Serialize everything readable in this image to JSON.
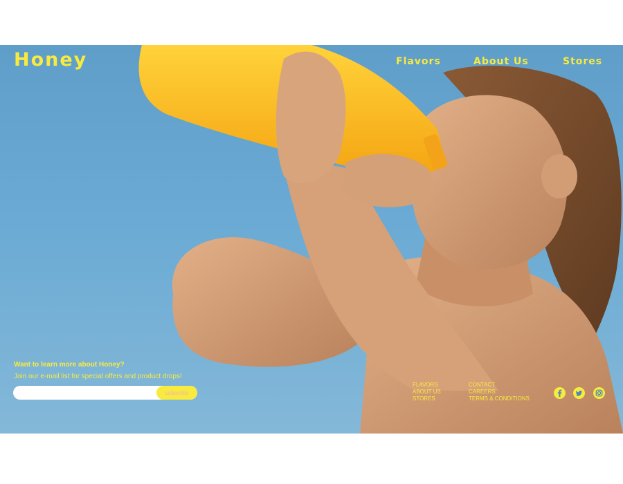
{
  "brand": {
    "logo": "Honey",
    "accent_color": "#f9ea3f"
  },
  "nav": {
    "items": [
      {
        "label": "Flavors"
      },
      {
        "label": "About Us"
      },
      {
        "label": "Stores"
      }
    ]
  },
  "hero": {
    "image": "child drinking orange juice from a bottle against a blue sky"
  },
  "newsletter": {
    "heading": "Want to learn more about Honey?",
    "subheading": "Join our e-mail list for special offers and product drops!",
    "email_value": "",
    "button_label": "subscribe"
  },
  "footer": {
    "col1": [
      {
        "label": "FLAVORS"
      },
      {
        "label": "ABOUT US"
      },
      {
        "label": "STORES"
      }
    ],
    "col2": [
      {
        "label": "CONTACT"
      },
      {
        "label": "CAREERS"
      },
      {
        "label": "TERMS & CONDITIONS"
      }
    ]
  },
  "social": {
    "icons": [
      "facebook-icon",
      "twitter-icon",
      "instagram-icon"
    ]
  }
}
